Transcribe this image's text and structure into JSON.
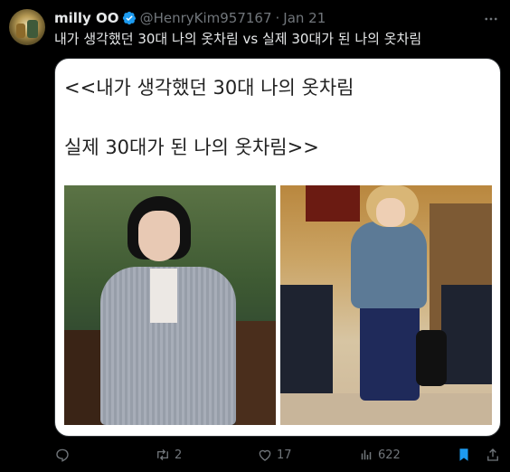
{
  "tweet": {
    "author_name": "milly OO",
    "handle": "@HenryKim957167",
    "separator": "·",
    "date": "Jan 21",
    "text": "내가 생각했던 30대 나의 옷차림 vs 실제 30대가 된 나의 옷차림"
  },
  "card": {
    "line1": "<<내가 생각했던 30대 나의 옷차림",
    "line2": "실제 30대가 된 나의 옷차림>>"
  },
  "actions": {
    "retweet_count": "2",
    "like_count": "17",
    "views_count": "622"
  },
  "colors": {
    "background": "#000000",
    "text": "#e7e9ea",
    "muted": "#71767b",
    "verified_blue": "#1d9bf0",
    "bookmark_blue": "#1d9bf0"
  },
  "icons": [
    "verified-icon",
    "more-icon",
    "reply-icon",
    "retweet-icon",
    "like-icon",
    "views-icon",
    "bookmark-icon",
    "share-icon"
  ]
}
